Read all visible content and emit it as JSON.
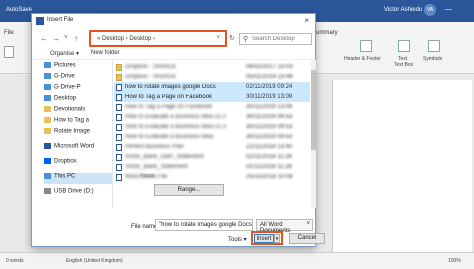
{
  "word": {
    "app_title": "AutoSave",
    "user_name": "Victor Ashiedu",
    "user_initials": "VA",
    "file_tab": "File",
    "ribbon_tab": "ummary",
    "header_footer": "Header & Footer",
    "text_label": "Text",
    "text_box": "Text Box",
    "symbols": "Symbols",
    "status_words": "0 words",
    "status_lang": "English (United Kingdom)",
    "status_zoom": "100%",
    "min_icon": "—"
  },
  "dialog": {
    "title": "Insert File",
    "close_icon": "×",
    "address_path": "« Desktop › Desktop ›",
    "search_placeholder": "Search Desktop",
    "toolbar": {
      "organise": "Organise ▾",
      "new_folder": "New folder"
    },
    "sidebar": [
      {
        "label": "Pictures",
        "color": "#4a90d9"
      },
      {
        "label": "G-Drive",
        "color": "#4a90d9"
      },
      {
        "label": "G-Drive-P",
        "color": "#4a90d9"
      },
      {
        "label": "Desktop",
        "color": "#4a90d9"
      },
      {
        "label": "Devotionals",
        "color": "#e6c15a"
      },
      {
        "label": "How to Tag a",
        "color": "#e6c15a"
      },
      {
        "label": "Rotate Image",
        "color": "#e6c15a"
      },
      {
        "label": "Microsoft Word",
        "color": "#2b579a"
      },
      {
        "label": "Dropbox",
        "color": "#0061fe"
      },
      {
        "label": "This PC",
        "color": "#4a90d9"
      },
      {
        "label": "USB Drive (D:)",
        "color": "#888888"
      }
    ],
    "files": [
      {
        "name": "Dropbox - Shortcut",
        "date": "06/02/2017 15:03",
        "type": "folder",
        "blur": true,
        "selected": false
      },
      {
        "name": "Dropbox - Shortcut",
        "date": "05/01/2019 23:48",
        "type": "folder",
        "blur": true,
        "selected": false
      },
      {
        "name": "how to rotate images google Docs",
        "date": "02/11/2019 09:24",
        "type": "doc",
        "blur": false,
        "selected": true
      },
      {
        "name": "How to Tag a Page on Facebook",
        "date": "30/11/2019 13:09",
        "type": "doc",
        "blur": false,
        "selected": true
      },
      {
        "name": "How to Tag a Page on Facebook",
        "date": "30/11/2019 13:09",
        "type": "doc",
        "blur": true,
        "selected": false
      },
      {
        "name": "How to Evaluate a Business Idea v1.0",
        "date": "30/11/2019 09:53",
        "type": "doc",
        "blur": true,
        "selected": false
      },
      {
        "name": "How to Evaluate a Business Idea v1.0",
        "date": "30/11/2019 09:53",
        "type": "doc",
        "blur": true,
        "selected": false
      },
      {
        "name": "How to Evaluate a Business Idea",
        "date": "30/11/2019 09:53",
        "type": "doc",
        "blur": true,
        "selected": false
      },
      {
        "name": "Perfect Business Plan",
        "date": "22/11/2018 13:40",
        "type": "doc",
        "blur": true,
        "selected": false
      },
      {
        "name": "Victor_Bank_GBP_Statement",
        "date": "02/11/2018 11:28",
        "type": "doc",
        "blur": true,
        "selected": false
      },
      {
        "name": "Victor_Bank_Statement",
        "date": "01/11/2018 11:28",
        "type": "doc",
        "blur": true,
        "selected": false
      },
      {
        "name": "Word Blank File",
        "date": "25/10/2018 10:08",
        "type": "doc",
        "blur": true,
        "selected": false
      }
    ],
    "range_label": "Range:",
    "range_button": "Range...",
    "file_name_label": "File name:",
    "file_name_value": "\"how to rotate images google Docs\" \"I",
    "file_type": "All Word Documents",
    "tools": "Tools ▾",
    "insert": "Insert",
    "insert_drop": "▾",
    "cancel": "Cancel"
  }
}
